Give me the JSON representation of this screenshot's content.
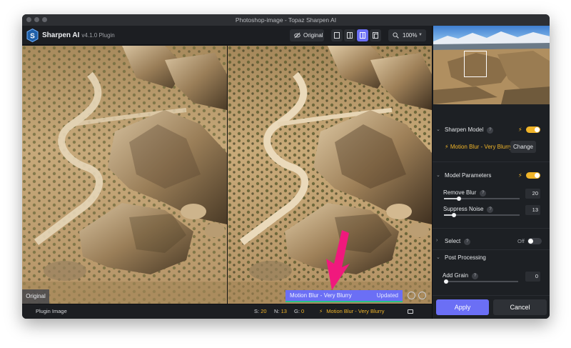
{
  "window": {
    "title": "Photoshop-image - Topaz Sharpen AI"
  },
  "toolbar": {
    "app_name": "Sharpen AI",
    "app_version": "v4.1.0 Plugin",
    "original_label": "Original",
    "zoom_label": "100%"
  },
  "canvas": {
    "original_tag": "Original",
    "status_model": "Motion Blur - Very Blurry",
    "status_state": "Updated"
  },
  "statusbar": {
    "left_label": "Plugin Image",
    "s_label": "S:",
    "s_value": "20",
    "n_label": "N:",
    "n_value": "13",
    "g_label": "G:",
    "g_value": "0",
    "model": "Motion Blur - Very Blurry"
  },
  "panel": {
    "sharpen_model": {
      "title": "Sharpen Model",
      "help": "?",
      "model_name": "Motion Blur - Very Blurry",
      "change_label": "Change",
      "enabled": true
    },
    "model_parameters": {
      "title": "Model Parameters",
      "help": "?",
      "enabled": true,
      "remove_blur": {
        "label": "Remove Blur",
        "help": "?",
        "value": "20",
        "level": 0.2
      },
      "suppress_noise": {
        "label": "Suppress Noise",
        "help": "?",
        "value": "13",
        "level": 0.13
      }
    },
    "select": {
      "title": "Select",
      "help": "?",
      "state": "Off"
    },
    "post_processing": {
      "title": "Post Processing",
      "add_grain": {
        "label": "Add Grain",
        "help": "?",
        "value": "0",
        "level": 0.0
      }
    },
    "apply_label": "Apply",
    "cancel_label": "Cancel"
  },
  "colors": {
    "accent": "#6b6ff5",
    "highlight": "#f0b429",
    "annotation_arrow": "#f0197d",
    "success": "#27c08a"
  },
  "icons": {
    "logo": "sharpen-ai-logo",
    "original_toggle": "eye-slash-icon",
    "zoom": "magnifier-icon",
    "bolt": "lightning-bolt-icon",
    "face": "smiley-icon",
    "camera": "camera-icon"
  }
}
